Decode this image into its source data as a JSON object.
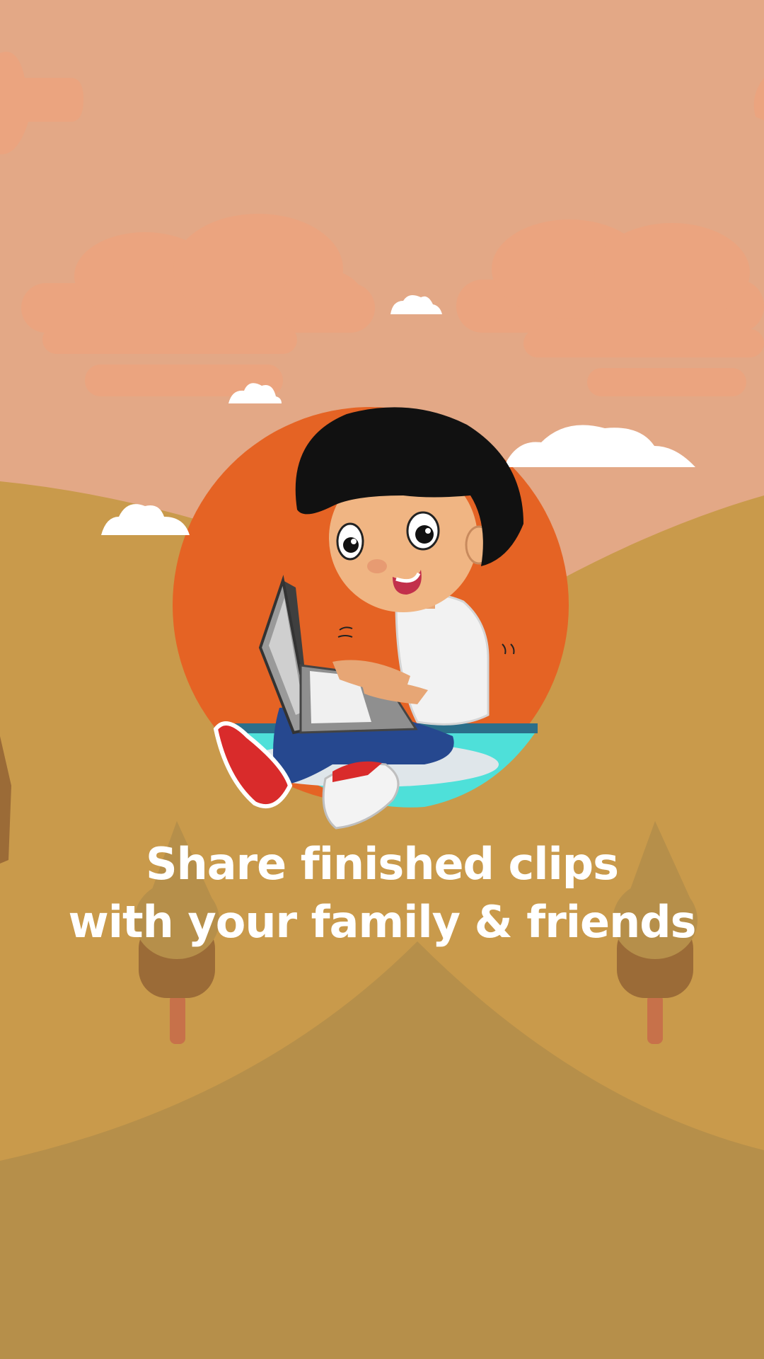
{
  "onboarding": {
    "headline_line1": "Share finished clips",
    "headline_line2": "with your family & friends"
  },
  "illustration": {
    "subject": "boy-with-laptop",
    "scene": "sunset-hills-with-clouds-and-trees"
  },
  "colors": {
    "sky": "#e3a886",
    "sky_cloud": "#eba47f",
    "sun": "#e56324",
    "hill": "#c99a4b",
    "ground": "#b68f4a",
    "tree": "#9b6b37",
    "tree_trunk": "#c7714a",
    "text": "#ffffff"
  }
}
